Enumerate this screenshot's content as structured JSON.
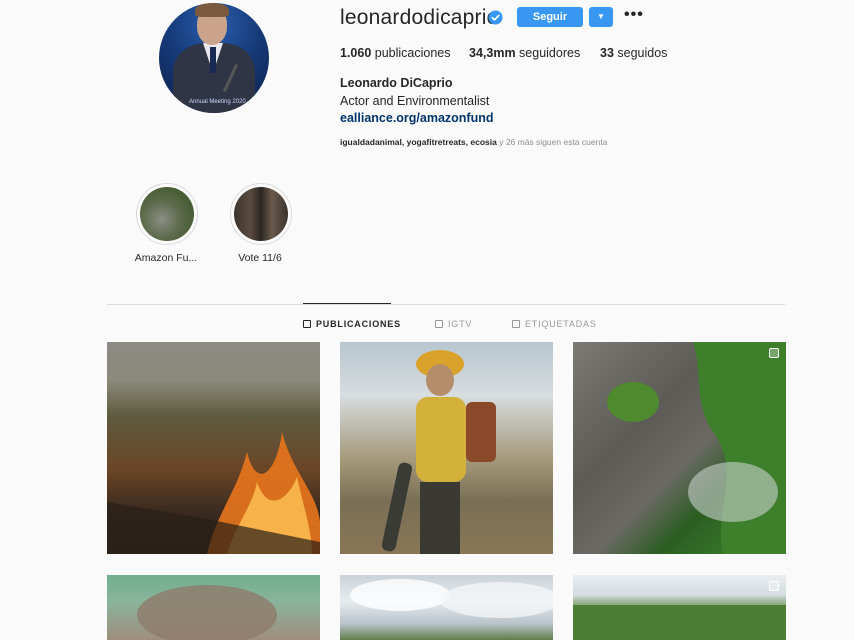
{
  "profile": {
    "username": "leonardodicaprio",
    "verified": true,
    "follow_label": "Seguir",
    "more_label": "•••",
    "stats": {
      "posts_num": "1.060",
      "posts_label": "publicaciones",
      "followers_num": "34,3mm",
      "followers_label": "seguidores",
      "following_num": "33",
      "following_label": "seguidos"
    },
    "full_name": "Leonardo DiCaprio",
    "bio": "Actor and Environmentalist",
    "link": "ealliance.org/amazonfund",
    "followed_by_names": "igualdadanimal, yogafitretreats, ecosia",
    "followed_by_rest": " y 26 más siguen esta cuenta"
  },
  "highlights": [
    {
      "label": "Amazon Fu..."
    },
    {
      "label": "Vote 11/6"
    }
  ],
  "tabs": [
    {
      "label": "PUBLICACIONES",
      "active": true
    },
    {
      "label": "IGTV",
      "active": false
    },
    {
      "label": "ETIQUETADAS",
      "active": false
    }
  ],
  "colors": {
    "accent": "#3897f0",
    "link": "#003569",
    "muted": "#8e8e8e"
  },
  "avatar_caption": "Annual Meeting 2020"
}
